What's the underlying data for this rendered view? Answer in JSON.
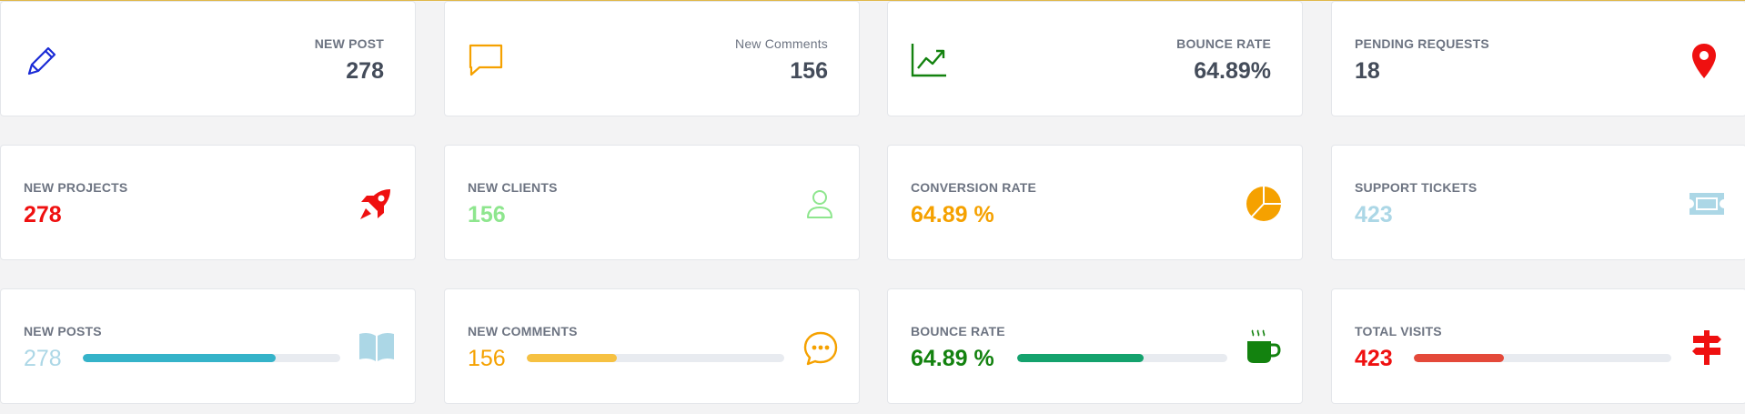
{
  "colors": {
    "blue": "#1a2bd6",
    "orange": "#f5a100",
    "green": "#13820f",
    "red": "#ef1010",
    "light_green": "#8ee68e",
    "light_blue": "#acd7e6",
    "teal_bar": "#35b3c9",
    "yellow_bar": "#f6c142",
    "green_bar": "#14a26d",
    "red_bar": "#e4493a"
  },
  "row1": [
    {
      "label": "NEW POST",
      "value": "278",
      "icon": "pencil-icon"
    },
    {
      "label": "New Comments",
      "value": "156",
      "icon": "chat-bubble-icon"
    },
    {
      "label": "BOUNCE RATE",
      "value": "64.89%",
      "icon": "line-chart-icon"
    },
    {
      "label": "PENDING REQUESTS",
      "value": "18",
      "icon": "map-marker-icon"
    }
  ],
  "row2": [
    {
      "label": "NEW PROJECTS",
      "value": "278",
      "icon": "rocket-icon"
    },
    {
      "label": "NEW CLIENTS",
      "value": "156",
      "icon": "user-icon"
    },
    {
      "label": "CONVERSION RATE",
      "value": "64.89 %",
      "icon": "pie-chart-icon"
    },
    {
      "label": "SUPPORT TICKETS",
      "value": "423",
      "icon": "ticket-icon"
    }
  ],
  "row3": [
    {
      "label": "NEW POSTS",
      "value": "278",
      "icon": "book-icon",
      "progress": 0.75
    },
    {
      "label": "NEW COMMENTS",
      "value": "156",
      "icon": "comment-dots-icon",
      "progress": 0.35
    },
    {
      "label": "BOUNCE RATE",
      "value": "64.89 %",
      "icon": "coffee-icon",
      "progress": 0.6
    },
    {
      "label": "TOTAL VISITS",
      "value": "423",
      "icon": "signpost-icon",
      "progress": 0.35
    }
  ]
}
